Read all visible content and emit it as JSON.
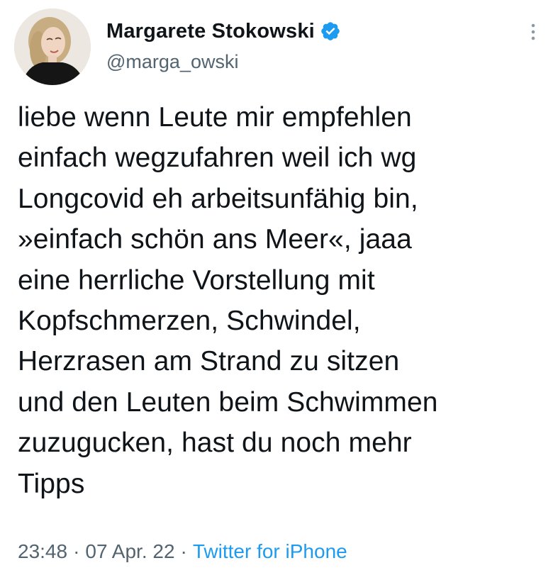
{
  "author": {
    "display_name": "Margarete Stokowski",
    "handle": "@marga_owski",
    "verified": true,
    "verified_icon": "verified-badge-icon"
  },
  "tweet": {
    "lines": [
      "liebe wenn Leute mir empfehlen",
      "einfach wegzufahren weil ich wg",
      "Longcovid eh arbeitsunfähig bin,",
      "»einfach schön ans Meer«, jaaa",
      "eine herrliche Vorstellung mit",
      "Kopfschmerzen, Schwindel,",
      "Herzrasen am Strand zu sitzen",
      "und den Leuten beim Schwimmen",
      "zuzugucken, hast du noch mehr",
      "Tipps"
    ],
    "time": "23:48",
    "date": "07 Apr. 22",
    "source": "Twitter for iPhone",
    "separator": "·"
  },
  "icons": {
    "more": "more-vertical-icon"
  },
  "colors": {
    "text": "#0f1419",
    "secondary": "#536471",
    "link": "#1d9bf0",
    "verified": "#1d9bf0"
  }
}
